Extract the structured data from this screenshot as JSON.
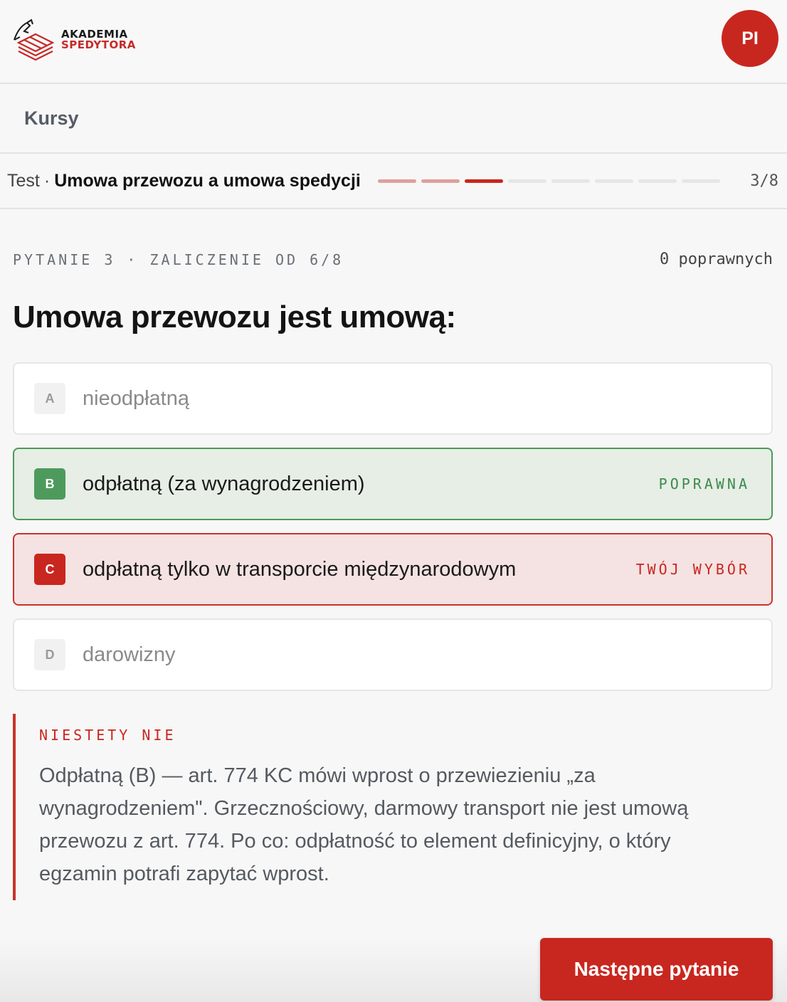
{
  "header": {
    "logo_line1": "AKADEMIA",
    "logo_line2": "SPEDYTORA",
    "avatar_initials": "PI",
    "brand_color": "#c8271f"
  },
  "nav": {
    "courses_label": "Kursy"
  },
  "test_bar": {
    "prefix": "Test",
    "separator": "·",
    "title": "Umowa przewozu a umowa spedycji",
    "current_question": 3,
    "total_questions": 8,
    "counter": "3/8"
  },
  "question": {
    "meta": "PYTANIE 3 · ZALICZENIE OD 6/8",
    "correct_count": "0 poprawnych",
    "text": "Umowa przewozu jest umową:",
    "options": [
      {
        "letter": "A",
        "text": "nieodpłatną",
        "state": "neutral",
        "tag": ""
      },
      {
        "letter": "B",
        "text": "odpłatną (za wynagrodzeniem)",
        "state": "correct",
        "tag": "POPRAWNA"
      },
      {
        "letter": "C",
        "text": "odpłatną tylko w transporcie międzynarodowym",
        "state": "wrong",
        "tag": "TWÓJ WYBÓR"
      },
      {
        "letter": "D",
        "text": "darowizny",
        "state": "neutral",
        "tag": ""
      }
    ]
  },
  "feedback": {
    "title": "NIESTETY NIE",
    "body": "Odpłatną (B) — art. 774 KC mówi wprost o przewiezieniu „za wynagrodzeniem\". Grzecznościowy, darmowy transport nie jest umową przewozu z art. 774. Po co: odpłatność to element definicyjny, o który egzamin potrafi zapytać wprost."
  },
  "actions": {
    "next_label": "Następne pytanie"
  }
}
